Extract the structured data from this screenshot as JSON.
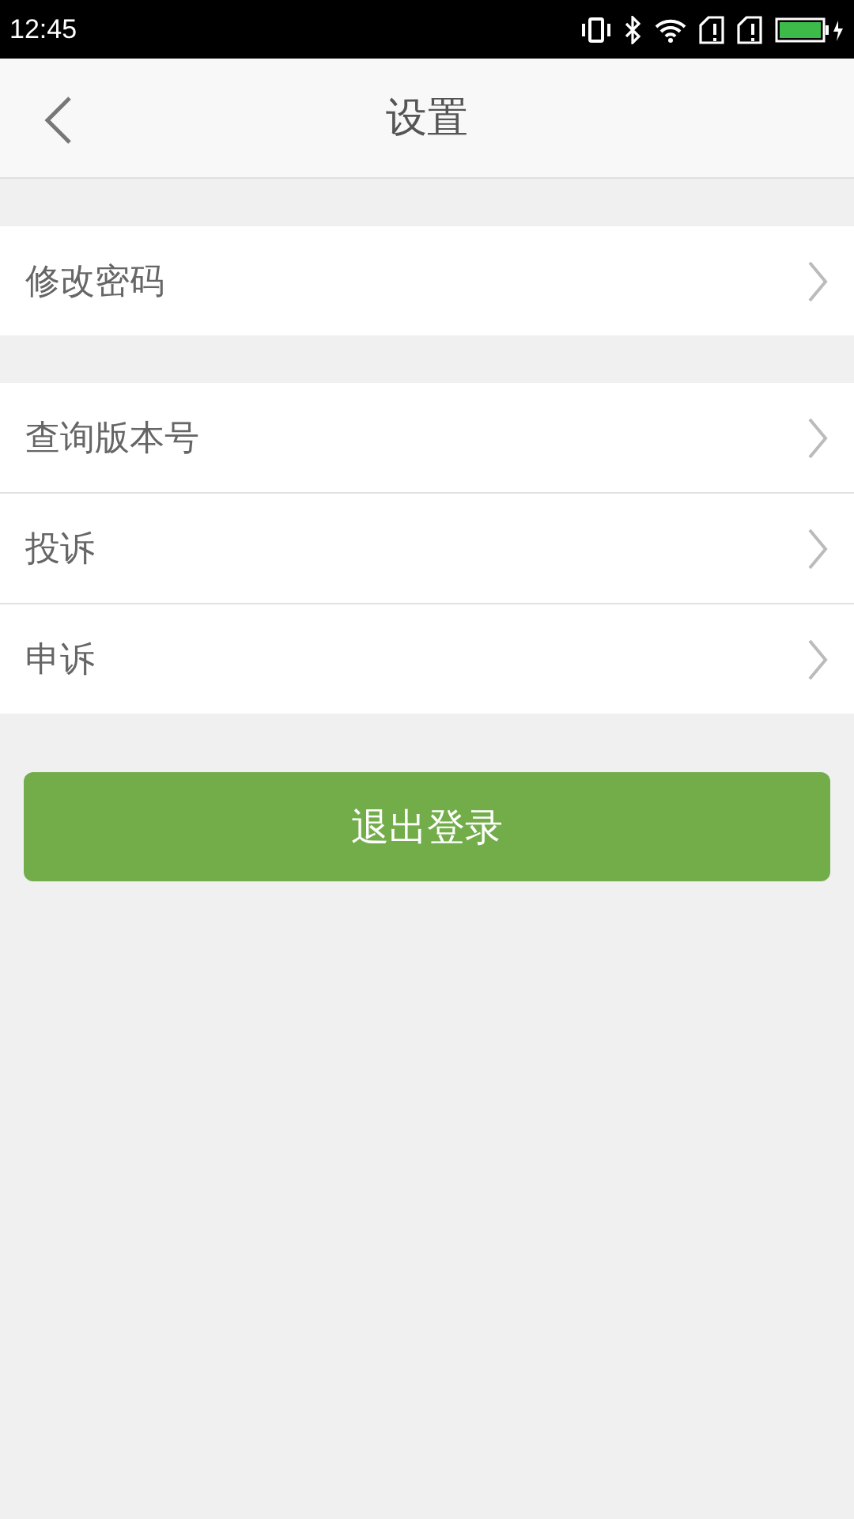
{
  "status_bar": {
    "time": "12:45"
  },
  "header": {
    "title": "设置"
  },
  "groups": [
    {
      "items": [
        {
          "label": "修改密码"
        }
      ]
    },
    {
      "items": [
        {
          "label": "查询版本号"
        },
        {
          "label": "投诉"
        },
        {
          "label": "申诉"
        }
      ]
    }
  ],
  "logout_button": "退出登录"
}
